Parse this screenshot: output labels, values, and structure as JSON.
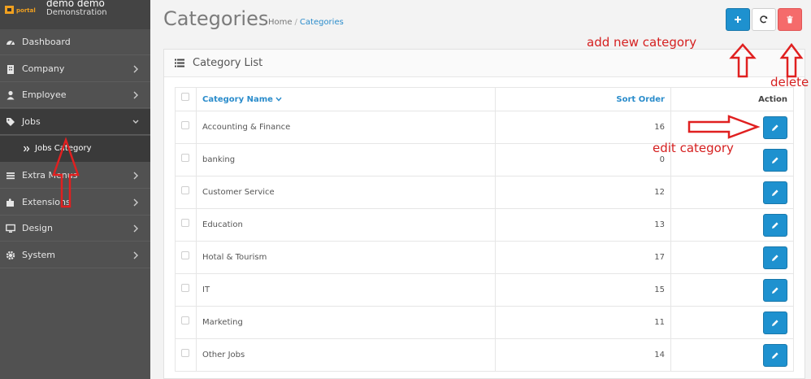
{
  "profile": {
    "logo_text": "portal",
    "user_name": "demo demo",
    "role": "Demonstration"
  },
  "sidebar": {
    "items": [
      {
        "label": "Dashboard",
        "icon": "dashboard-icon"
      },
      {
        "label": "Company",
        "icon": "building-icon"
      },
      {
        "label": "Employee",
        "icon": "user-icon"
      },
      {
        "label": "Jobs",
        "icon": "tag-icon"
      },
      {
        "label": "Extra Menus",
        "icon": "bars-icon"
      },
      {
        "label": "Extensions",
        "icon": "puzzle-icon"
      },
      {
        "label": "Design",
        "icon": "desktop-icon"
      },
      {
        "label": "System",
        "icon": "cog-icon"
      }
    ],
    "sub_item": "Jobs Category"
  },
  "header": {
    "title": "Categories",
    "breadcrumb": [
      "Home",
      "Categories"
    ]
  },
  "panel": {
    "title": "Category List"
  },
  "table": {
    "columns": [
      "Category Name",
      "Sort Order",
      "Action"
    ],
    "rows": [
      {
        "name": "Accounting & Finance",
        "sort": "16"
      },
      {
        "name": "banking",
        "sort": "0"
      },
      {
        "name": "Customer Service",
        "sort": "12"
      },
      {
        "name": "Education",
        "sort": "13"
      },
      {
        "name": "Hotal & Tourism",
        "sort": "17"
      },
      {
        "name": "IT",
        "sort": "15"
      },
      {
        "name": "Marketing",
        "sort": "11"
      },
      {
        "name": "Other Jobs",
        "sort": "14"
      }
    ]
  },
  "annotations": {
    "add": "add new category",
    "delete": "delete",
    "edit": "edit category"
  },
  "colors": {
    "primary": "#1e91cf",
    "danger": "#f56b6b",
    "sidebar": "#515151",
    "annotation": "#d51f1f"
  }
}
